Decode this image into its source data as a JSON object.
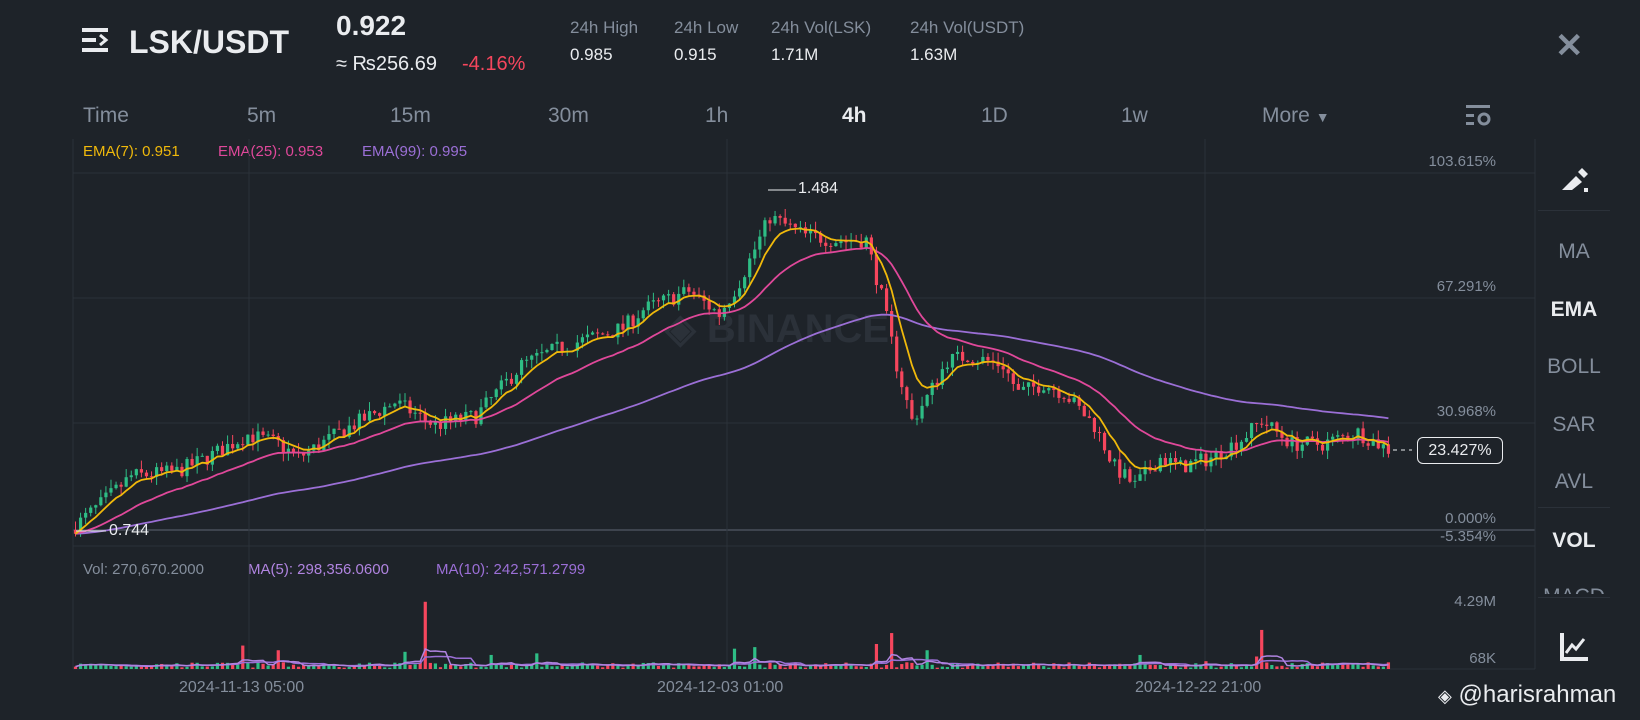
{
  "header": {
    "pair": "LSK/USDT",
    "price": "0.922",
    "fiat": "≈ ₨256.69",
    "change": "-4.16%",
    "stats": [
      {
        "label": "24h High",
        "value": "0.985"
      },
      {
        "label": "24h Low",
        "value": "0.915"
      },
      {
        "label": "24h Vol(LSK)",
        "value": "1.71M"
      },
      {
        "label": "24h Vol(USDT)",
        "value": "1.63M"
      }
    ]
  },
  "tabs": [
    "Time",
    "5m",
    "15m",
    "30m",
    "1h",
    "4h",
    "1D",
    "1w",
    "More"
  ],
  "active_tab": "4h",
  "indicators": [
    "MA",
    "EMA",
    "BOLL",
    "SAR",
    "AVL",
    "VOL",
    "MACD"
  ],
  "legend": {
    "ema7": "EMA(7): 0.951",
    "ema25": "EMA(25): 0.953",
    "ema99": "EMA(99): 0.995"
  },
  "vol_legend": {
    "vol": "Vol: 270,670.2000",
    "ma5": "MA(5): 298,356.0600",
    "ma10": "MA(10): 242,571.2799"
  },
  "watermark": "@harisrahman",
  "colors": {
    "up": "#2ebd85",
    "down": "#f6465d",
    "ema7": "#f0b90b",
    "ema25": "#e0489a",
    "ema99": "#9b6fd6"
  },
  "chart_data": {
    "type": "candlestick",
    "base_price": 0.744,
    "candle_count": 260,
    "y_tick_labels": [
      "103.615%",
      "67.291%",
      "30.968%",
      "0.000%",
      "-5.354%"
    ],
    "current_label": "23.427%",
    "high_label": "1.484",
    "low_label": "0.744",
    "vol_tick_labels": [
      "4.29M",
      "68K"
    ],
    "x_tick_labels": [
      "2024-11-13 05:00",
      "2024-12-03 01:00",
      "2024-12-22 21:00"
    ],
    "close_path": [
      [
        0,
        0.744
      ],
      [
        6,
        0.8
      ],
      [
        12,
        0.86
      ],
      [
        21,
        0.87
      ],
      [
        27,
        0.9
      ],
      [
        35,
        0.95
      ],
      [
        41,
        0.93
      ],
      [
        45,
        0.9
      ],
      [
        54,
        0.96
      ],
      [
        64,
        1.02
      ],
      [
        72,
        0.97
      ],
      [
        80,
        0.99
      ],
      [
        89,
        1.1
      ],
      [
        97,
        1.14
      ],
      [
        109,
        1.18
      ],
      [
        113,
        1.22
      ],
      [
        122,
        1.26
      ],
      [
        128,
        1.21
      ],
      [
        132,
        1.28
      ],
      [
        138,
        1.42
      ],
      [
        145,
        1.38
      ],
      [
        151,
        1.37
      ],
      [
        157,
        1.37
      ],
      [
        160,
        1.25
      ],
      [
        163,
        1.1
      ],
      [
        166,
        0.98
      ],
      [
        169,
        1.03
      ],
      [
        173,
        1.11
      ],
      [
        177,
        1.12
      ],
      [
        184,
        1.1
      ],
      [
        187,
        1.04
      ],
      [
        192,
        1.06
      ],
      [
        196,
        1.04
      ],
      [
        202,
        0.97
      ],
      [
        206,
        0.88
      ],
      [
        210,
        0.84
      ],
      [
        215,
        0.9
      ],
      [
        219,
        0.88
      ],
      [
        225,
        0.9
      ],
      [
        231,
        0.94
      ],
      [
        235,
        0.98
      ],
      [
        241,
        0.93
      ],
      [
        247,
        0.93
      ],
      [
        254,
        0.955
      ],
      [
        260,
        0.918
      ]
    ],
    "volume_spikes_millions": [
      [
        33,
        1.5
      ],
      [
        40,
        1.2
      ],
      [
        65,
        1.1
      ],
      [
        69,
        4.3
      ],
      [
        82,
        0.9
      ],
      [
        91,
        1.0
      ],
      [
        130,
        1.3
      ],
      [
        134,
        1.4
      ],
      [
        158,
        1.6
      ],
      [
        161,
        2.3
      ],
      [
        168,
        1.2
      ],
      [
        210,
        0.9
      ],
      [
        223,
        0.5
      ],
      [
        233,
        0.8
      ],
      [
        234,
        2.5
      ]
    ]
  }
}
